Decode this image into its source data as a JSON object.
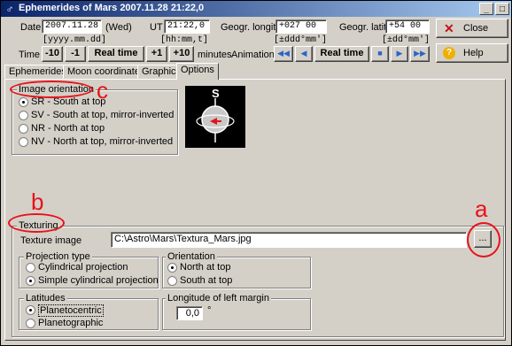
{
  "window": {
    "title": "Ephemerides of Mars  2007.11.28  21:22,0",
    "min_glyph": "_",
    "max_glyph": "□",
    "close_glyph": "x"
  },
  "date_row": {
    "date_label": "Date",
    "date_value": "2007.11.28",
    "weekday": "(Wed)",
    "date_format": "[yyyy.mm.dd]",
    "ut_label": "UT",
    "ut_value": "21:22,0",
    "ut_format": "[hh:mm,t]",
    "longit_label": "Geogr. longit.",
    "longit_value": "+027 00",
    "longit_format": "[±ddd°mm']",
    "latit_label": "Geogr. latit.",
    "latit_value": "+54 00",
    "latit_format": "[±dd°mm']",
    "close_label": "Close",
    "help_label": "Help"
  },
  "time_row": {
    "time_label": "Time",
    "minus10": "-10",
    "minus1": "-1",
    "realtime": "Real time",
    "plus1": "+1",
    "plus10": "+10",
    "minutes_label": "minutes",
    "animation_label": "Animation",
    "anim_realtime": "Real time"
  },
  "tabs": [
    "Ephemerides",
    "Moon coordinates",
    "Graphics",
    "Options"
  ],
  "image_orientation": {
    "title": "Image orientation",
    "options": [
      "SR - South at top",
      "SV - South at top, mirror-inverted",
      "NR - North at top",
      "NV - North at top, mirror-inverted"
    ],
    "selected": 0,
    "preview_s": "S"
  },
  "texturing": {
    "title": "Texturing",
    "image_label": "Texture image",
    "image_path": "C:\\Astro\\Mars\\Textura_Mars.jpg",
    "browse_label": "...",
    "projection_title": "Projection type",
    "projections": [
      "Cylindrical projection",
      "Simple cylindrical projection"
    ],
    "projection_selected": 1,
    "orientation_title": "Orientation",
    "orientations": [
      "North at top",
      "South at top"
    ],
    "orientation_selected": 0,
    "latitudes_title": "Latitudes",
    "latitudes": [
      "Planetocentric",
      "Planetographic"
    ],
    "latitude_selected": 0,
    "longitude_title": "Longitude of left margin",
    "longitude_value": "0,0",
    "longitude_unit": "°"
  },
  "annotations": {
    "a": "a",
    "b": "b",
    "c": "c"
  },
  "colors": {
    "annotation": "#e8121a",
    "title_start": "#0a246a",
    "title_end": "#a6caf0"
  }
}
